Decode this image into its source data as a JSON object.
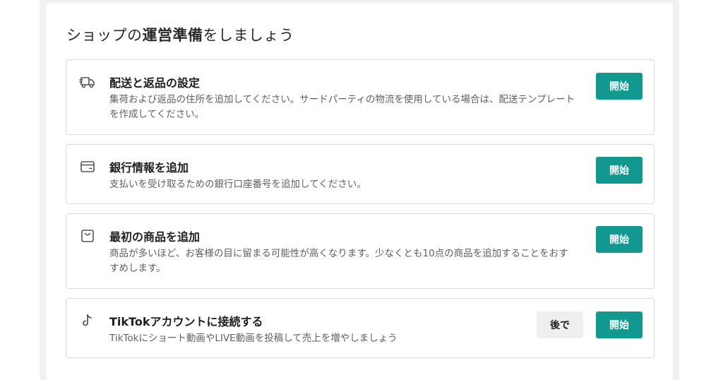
{
  "panel": {
    "title_prefix": "ショップの",
    "title_strong": "運営準備",
    "title_suffix": "をしましょう"
  },
  "tasks": [
    {
      "icon": "truck-icon",
      "title": "配送と返品の設定",
      "description": "集荷および返品の住所を追加してください。サードパーティの物流を使用している場合は、配送テンプレートを作成してください。",
      "start_label": "開始"
    },
    {
      "icon": "card-icon",
      "title": "銀行情報を追加",
      "description": "支払いを受け取るための銀行口座番号を追加してください。",
      "start_label": "開始"
    },
    {
      "icon": "shopping-bag-icon",
      "title": "最初の商品を追加",
      "description": "商品が多いほど、お客様の目に留まる可能性が高くなります。少なくとも10点の商品を追加することをおすすめします。",
      "start_label": "開始"
    },
    {
      "icon": "tiktok-icon",
      "title": "TikTokアカウントに接続する",
      "description": "TikTokにショート動画やLIVE動画を投稿して売上を増やしましょう",
      "later_label": "後で",
      "start_label": "開始"
    }
  ],
  "colors": {
    "accent": "#12998f",
    "later_button_bg": "#efefef",
    "card_border": "#dadada",
    "backdrop": "#f1f1f2"
  }
}
